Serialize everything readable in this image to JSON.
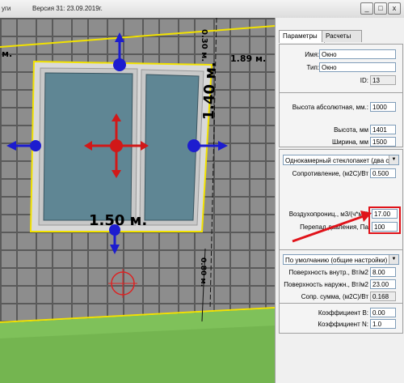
{
  "window": {
    "title_left": "уги",
    "version_label": "Версия 31: 23.09.2019г.",
    "buttons": [
      "_",
      "□",
      "x"
    ]
  },
  "viewport": {
    "dimensions": {
      "top_label": "0.30 м.",
      "left_label": "м.",
      "right_label": "1.89 м.",
      "height_label": "1.40 м.",
      "width_label": "1.50 м.",
      "bottom_label": "0.80 м."
    }
  },
  "panel": {
    "tabs": [
      "Параметры",
      "Расчеты"
    ],
    "active_tab": "Параметры",
    "identity": {
      "name_label": "Имя:",
      "name_value": "Окно",
      "type_label": "Тип:",
      "type_value": "Окно",
      "id_label": "ID:",
      "id_value": "13"
    },
    "size": {
      "abs_height_label": "Высота абсолютная, мм.:",
      "abs_height_value": "1000",
      "height_label": "Высота, мм",
      "height_value": "1401",
      "width_label": "Ширина, мм",
      "width_value": "1500"
    },
    "glazing": {
      "type_value": "Однокамерный стеклопакет (два с",
      "resistance_label": "Сопротивление, (м2C)/Вт",
      "resistance_value": "0.500",
      "air_perm_label": "Воздухопрониц., м3/(ч*м2)",
      "air_perm_value": "17.00",
      "pressure_label": "Перепад давления, Па",
      "pressure_value": "100"
    },
    "surface": {
      "mode_value": "По умолчанию (общие настройки)",
      "inner_label": "Поверхность внутр., Вт/м2",
      "inner_value": "8.00",
      "outer_label": "Поверхность наружн., Вт/м2",
      "outer_value": "23.00",
      "sum_label": "Сопр. сумма, (м2C)/Вт",
      "sum_value": "0.168"
    },
    "coefficients": {
      "b_label": "Коэффициент B:",
      "b_value": "0.00",
      "n_label": "Коэффициент N:",
      "n_value": "1.0"
    }
  },
  "colors": {
    "highlight": "#e0131a",
    "outline": "#f2e200",
    "axis_blue": "#1c1ccf",
    "axis_red": "#d11818"
  }
}
